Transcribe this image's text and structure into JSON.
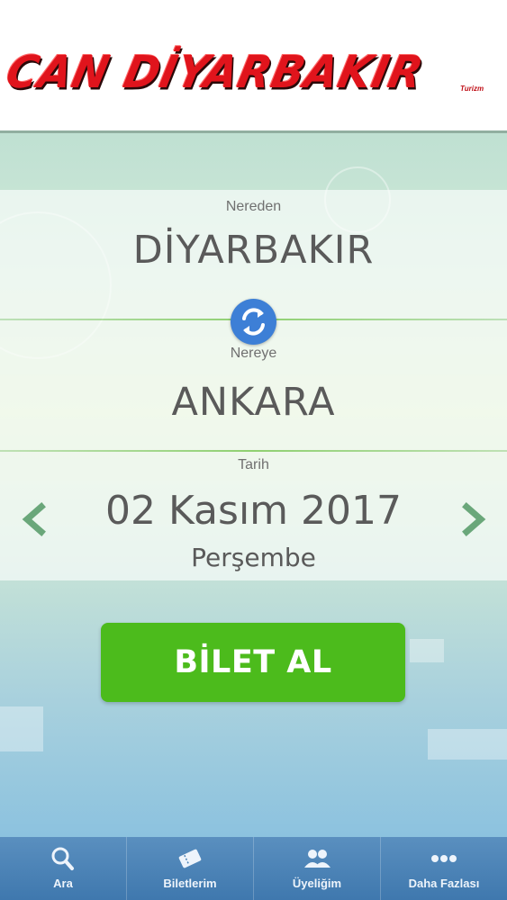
{
  "header": {
    "logo_text": "CAN DİYARBAKIR",
    "logo_sub": "Turizm"
  },
  "search": {
    "from_label": "Nereden",
    "from_value": "DİYARBAKIR",
    "to_label": "Nereye",
    "to_value": "ANKARA",
    "date_label": "Tarih",
    "date_value": "02 Kasım 2017",
    "weekday": "Perşembe",
    "swap_icon": "swap-icon",
    "prev_icon": "chevron-left-icon",
    "next_icon": "chevron-right-icon"
  },
  "actions": {
    "buy_label": "BİLET AL"
  },
  "tabs": [
    {
      "label": "Ara",
      "icon": "search-icon"
    },
    {
      "label": "Biletlerim",
      "icon": "ticket-icon"
    },
    {
      "label": "Üyeliğim",
      "icon": "users-icon"
    },
    {
      "label": "Daha Fazlası",
      "icon": "more-icon"
    }
  ],
  "colors": {
    "brand_red": "#e0141c",
    "buy_green": "#4cbb1c",
    "swap_blue": "#3d7fd6",
    "tabbar_blue": "#4a82b6"
  }
}
